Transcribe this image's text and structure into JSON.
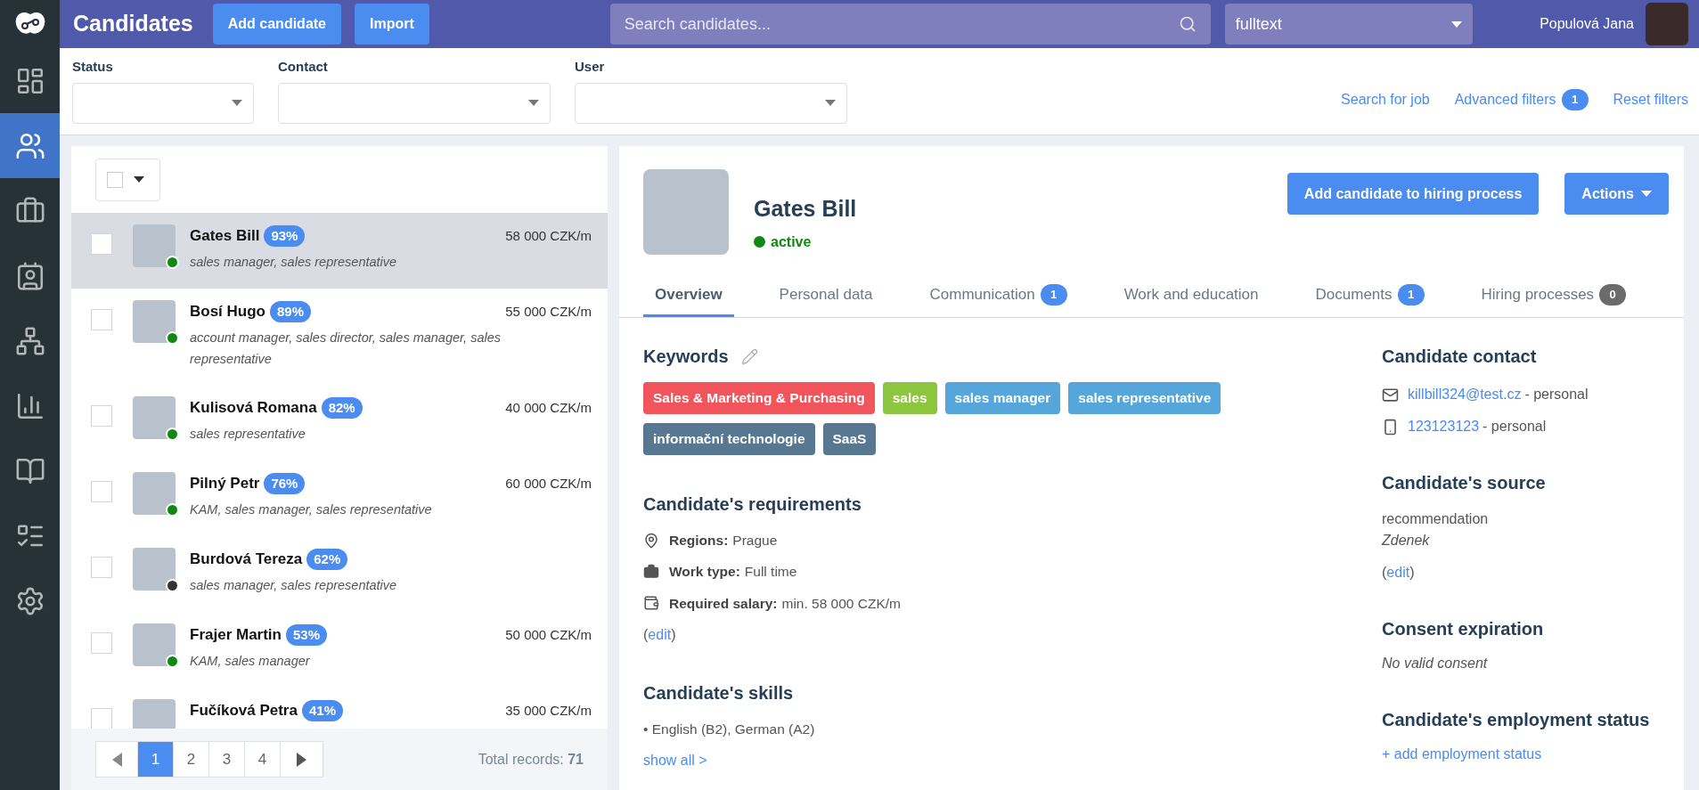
{
  "app": {
    "title": "Candidates",
    "buttons": [
      "Add candidate",
      "Import"
    ],
    "search": {
      "placeholder": "Search candidates..."
    },
    "search_mode": "fulltext",
    "user": "Populová Jana"
  },
  "nav": [
    {
      "kind": "dashboard",
      "selected": false
    },
    {
      "kind": "candidates",
      "selected": true
    },
    {
      "kind": "jobs",
      "selected": false
    },
    {
      "kind": "contacts",
      "selected": false
    },
    {
      "kind": "structure",
      "selected": false
    },
    {
      "kind": "reports",
      "selected": false
    },
    {
      "kind": "guide",
      "selected": false
    },
    {
      "kind": "tasks",
      "selected": false
    },
    {
      "kind": "settings",
      "selected": false
    }
  ],
  "filters": [
    {
      "label": "Status"
    },
    {
      "label": "Contact"
    },
    {
      "label": "User"
    }
  ],
  "filter_links": [
    {
      "label": "Search for job"
    },
    {
      "label": "Advanced filters",
      "badge": "1"
    },
    {
      "label": "Reset filters"
    }
  ],
  "list": {
    "select_all": {
      "checked": false
    },
    "candidates": [
      {
        "name": "Gates Bill",
        "match": "93%",
        "salary": "58 000 CZK/m",
        "roles": "sales manager, sales representative",
        "color": "#118811",
        "checked": false,
        "selected": true
      },
      {
        "name": "Bosí Hugo",
        "match": "89%",
        "salary": "55 000 CZK/m",
        "roles": "account manager, sales director, sales manager, sales representative",
        "color": "#118811",
        "checked": false,
        "selected": false
      },
      {
        "name": "Kulisová Romana",
        "match": "82%",
        "salary": "40 000 CZK/m",
        "roles": "sales representative",
        "color": "#118811",
        "checked": false,
        "selected": false
      },
      {
        "name": "Pilný Petr",
        "match": "76%",
        "salary": "60 000 CZK/m",
        "roles": "KAM, sales manager, sales representative",
        "color": "#118811",
        "checked": false,
        "selected": false
      },
      {
        "name": "Burdová Tereza",
        "match": "62%",
        "roles": "sales manager, sales representative",
        "color": "#333333",
        "checked": false,
        "selected": false
      },
      {
        "name": "Frajer Martin",
        "match": "53%",
        "salary": "50 000 CZK/m",
        "roles": "KAM, sales manager",
        "color": "#118811",
        "checked": false,
        "selected": false
      },
      {
        "name": "Fučíková Petra",
        "match": "41%",
        "salary": "35 000 CZK/m",
        "checked": false,
        "selected": false
      }
    ],
    "pagination": {
      "pages": [
        {
          "label": "1",
          "selected": true
        },
        {
          "label": "2",
          "selected": false
        },
        {
          "label": "3",
          "selected": false
        },
        {
          "label": "4",
          "selected": false
        }
      ]
    },
    "total": "Total records: **71**"
  },
  "detail": {
    "name": "Gates Bill",
    "status": "active",
    "buttons": [
      "Add candidate to hiring process",
      "Actions"
    ],
    "tabs": [
      {
        "label": "Overview",
        "selected": true
      },
      {
        "label": "Personal data",
        "selected": false
      },
      {
        "label": "Communication",
        "selected": false,
        "badge": "1",
        "color": "#4a8cf0"
      },
      {
        "label": "Work and education",
        "selected": false
      },
      {
        "label": "Documents",
        "selected": false,
        "badge": "1",
        "color": "#4a8cf0"
      },
      {
        "label": "Hiring processes",
        "selected": false,
        "badge": "0",
        "color": "#6b6b6b"
      }
    ],
    "keywords": {
      "title": "Keywords",
      "tags": [
        {
          "label": "Sales & Marketing & Purchasing",
          "color": "#f2545b"
        },
        {
          "label": "sales",
          "color": "#8cc63f"
        },
        {
          "label": "sales manager",
          "color": "#54a6db"
        },
        {
          "label": "sales representative",
          "color": "#54a6db"
        },
        {
          "label": "informační technologie",
          "color": "#587891"
        },
        {
          "label": "SaaS",
          "color": "#587891"
        }
      ]
    },
    "requirements": {
      "title": "Candidate's requirements",
      "items": [
        {
          "kind": "region",
          "label": "Regions:",
          "value": "Prague"
        },
        {
          "kind": "work_type",
          "label": "Work type:",
          "value": "Full time"
        },
        {
          "kind": "salary",
          "label": "Required salary:",
          "value": "min. 58 000 CZK/m"
        }
      ],
      "edit": {
        "before": "(",
        "link": "edit",
        "after": ")"
      }
    },
    "skills": {
      "title": "Candidate's skills",
      "text": "• English (B2), German (A2)",
      "link": "show all >"
    },
    "contact": {
      "title": "Candidate contact",
      "items": [
        {
          "kind": "email",
          "value": "killbill324@test.cz",
          "note": "- personal"
        },
        {
          "kind": "phone",
          "value": "123123123",
          "note": "- personal"
        }
      ]
    },
    "source": {
      "title": "Candidate's source",
      "value": "recommendation",
      "person": "Zdenek",
      "edit": {
        "before": "(",
        "link": "edit",
        "after": ")"
      }
    },
    "consent": {
      "title": "Consent expiration",
      "text": "No valid consent"
    },
    "employment": {
      "title": "Candidate's employment status",
      "link": "+ add employment status"
    }
  }
}
